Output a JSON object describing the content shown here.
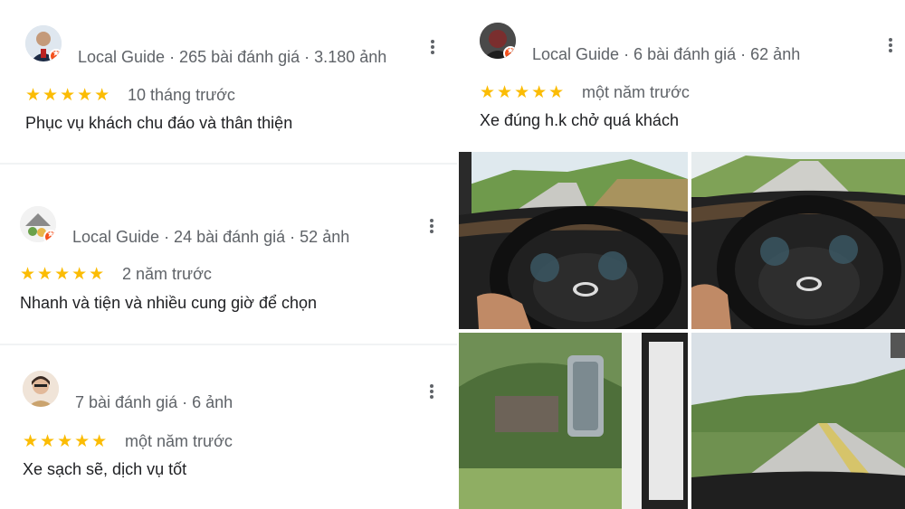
{
  "reviews": [
    {
      "meta": "Local Guide · 265 bài đánh giá · 3.180 ảnh",
      "rating": 5,
      "stars": "★★★★★",
      "when": "10 tháng trước",
      "text": "Phục vụ khách chu đáo và thân thiện"
    },
    {
      "meta": "Local Guide · 24 bài đánh giá · 52 ảnh",
      "rating": 5,
      "stars": "★★★★★",
      "when": "2 năm trước",
      "text": "Nhanh và tiện và nhiều cung giờ để chọn"
    },
    {
      "meta": "7 bài đánh giá · 6 ảnh",
      "rating": 5,
      "stars": "★★★★★",
      "when": "một năm trước",
      "text": "Xe sạch sẽ, dịch vụ tốt"
    },
    {
      "meta": "Local Guide · 6 bài đánh giá · 62 ảnh",
      "rating": 5,
      "stars": "★★★★★",
      "when": "một năm trước",
      "text": "Xe đúng h.k chở quá khách"
    }
  ],
  "colors": {
    "star": "#fbbc04",
    "meta": "#5f6368",
    "badge": "#f4511e"
  }
}
